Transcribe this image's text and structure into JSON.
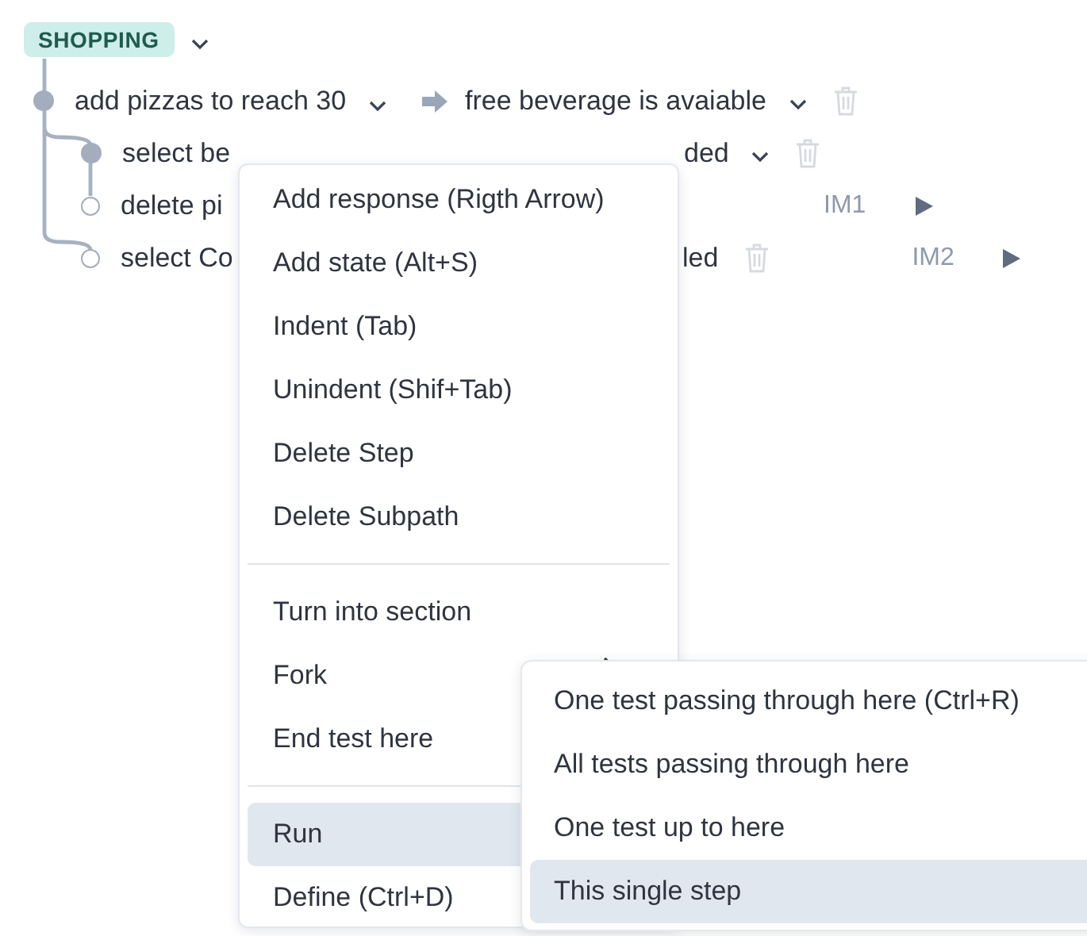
{
  "section": {
    "label": "SHOPPING"
  },
  "steps": [
    {
      "action": "add pizzas to reach 30",
      "response": "free beverage is avaiable",
      "children": [
        {
          "action": "select be",
          "response": "ded",
          "children": [
            {
              "action": "delete pi",
              "tag": "IM1"
            }
          ]
        },
        {
          "action": "select Co",
          "response": "led",
          "tag": "IM2"
        }
      ]
    }
  ],
  "context_menu": {
    "groups": [
      [
        {
          "label": "Add response (Rigth Arrow)",
          "selected": false,
          "submenu": false
        },
        {
          "label": "Add state (Alt+S)",
          "selected": false,
          "submenu": false
        },
        {
          "label": "Indent (Tab)",
          "selected": false,
          "submenu": false
        },
        {
          "label": "Unindent (Shif+Tab)",
          "selected": false,
          "submenu": false
        },
        {
          "label": "Delete Step",
          "selected": false,
          "submenu": false
        },
        {
          "label": "Delete Subpath",
          "selected": false,
          "submenu": false
        }
      ],
      [
        {
          "label": "Turn into section",
          "selected": false,
          "submenu": false
        },
        {
          "label": "Fork",
          "selected": false,
          "submenu": true
        },
        {
          "label": "End test here",
          "selected": false,
          "submenu": false
        }
      ],
      [
        {
          "label": "Run",
          "selected": true,
          "submenu": false
        },
        {
          "label": "Define (Ctrl+D)",
          "selected": false,
          "submenu": false
        }
      ]
    ]
  },
  "submenu": {
    "items": [
      {
        "label": "One test passing through here (Ctrl+R)",
        "selected": false
      },
      {
        "label": "All tests passing through here",
        "selected": false
      },
      {
        "label": "One test up to here",
        "selected": false
      },
      {
        "label": "This single step",
        "selected": true
      }
    ]
  }
}
